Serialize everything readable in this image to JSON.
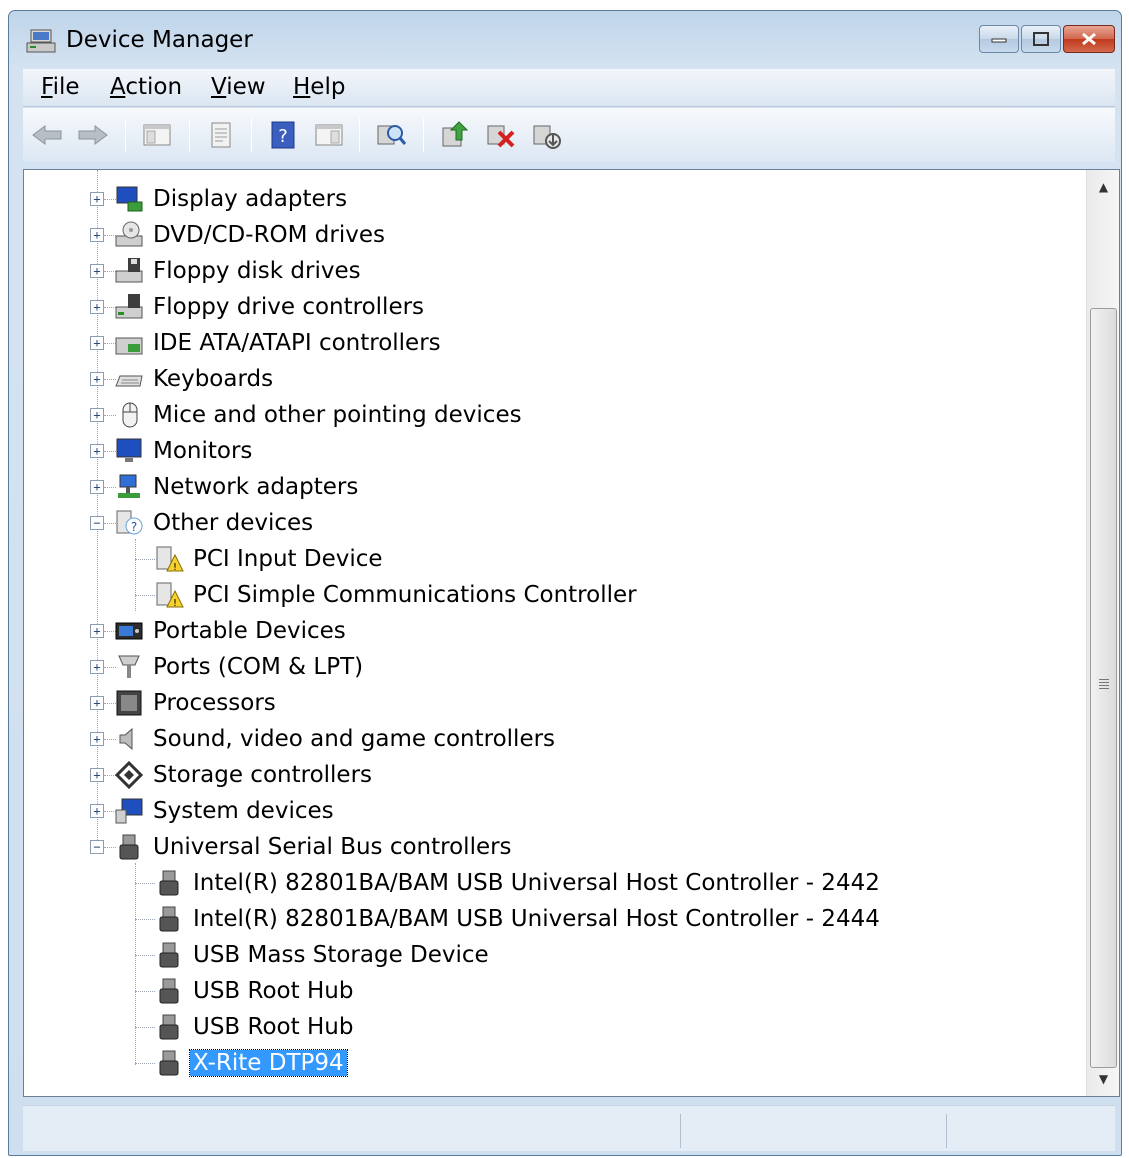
{
  "window": {
    "title": "Device Manager"
  },
  "menu": {
    "file": {
      "u": "F",
      "rest": "ile"
    },
    "action": {
      "u": "A",
      "rest": "ction"
    },
    "view": {
      "u": "V",
      "rest": "iew"
    },
    "help": {
      "u": "H",
      "rest": "elp"
    }
  },
  "tree": {
    "categories": [
      "Display adapters",
      "DVD/CD-ROM drives",
      "Floppy disk drives",
      "Floppy drive controllers",
      "IDE ATA/ATAPI controllers",
      "Keyboards",
      "Mice and other pointing devices",
      "Monitors",
      "Network adapters",
      "Other devices",
      "Portable Devices",
      "Ports (COM & LPT)",
      "Processors",
      "Sound, video and game controllers",
      "Storage controllers",
      "System devices",
      "Universal Serial Bus controllers"
    ],
    "other_devices": [
      "PCI Input Device",
      "PCI Simple Communications Controller"
    ],
    "usb_devices": [
      "Intel(R) 82801BA/BAM USB Universal Host Controller - 2442",
      "Intel(R) 82801BA/BAM USB Universal Host Controller - 2444",
      "USB Mass Storage Device",
      "USB Root Hub",
      "USB Root Hub",
      "X-Rite DTP94"
    ],
    "selected": "X-Rite DTP94",
    "expand_symbol": "+",
    "collapse_symbol": "−"
  },
  "colors": {
    "selection": "#3399ff",
    "window_frame": "#bfd5ea"
  }
}
